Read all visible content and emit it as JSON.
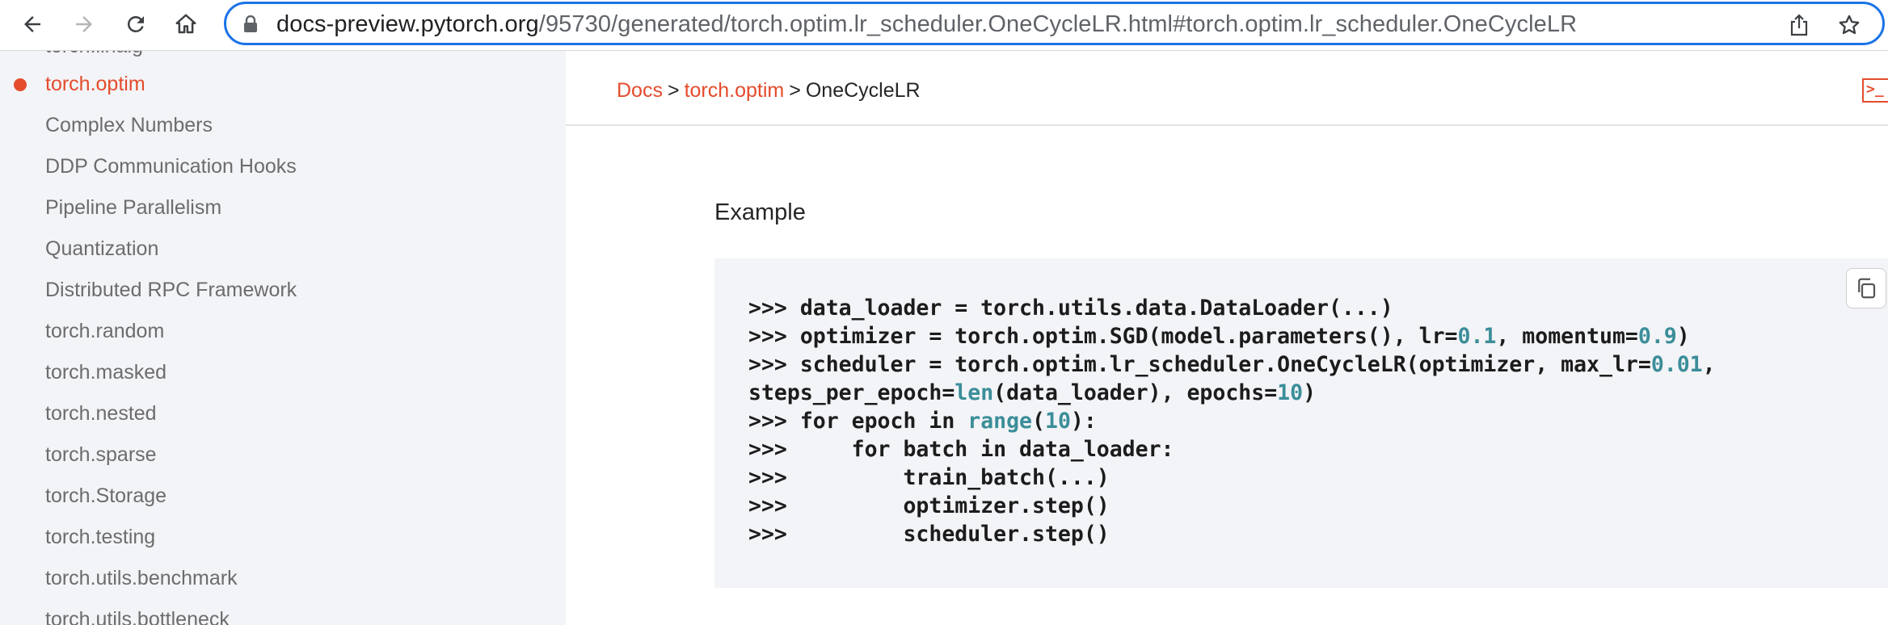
{
  "browser": {
    "url_host": "docs-preview.pytorch.org",
    "url_path": "/95730/generated/torch.optim.lr_scheduler.OneCycleLR.html#torch.optim.lr_scheduler.OneCycleLR"
  },
  "sidebar": {
    "partial_top": "torch.linalg",
    "items": [
      {
        "label": "torch.optim",
        "active": true
      },
      {
        "label": "Complex Numbers"
      },
      {
        "label": "DDP Communication Hooks"
      },
      {
        "label": "Pipeline Parallelism"
      },
      {
        "label": "Quantization"
      },
      {
        "label": "Distributed RPC Framework"
      },
      {
        "label": "torch.random"
      },
      {
        "label": "torch.masked"
      },
      {
        "label": "torch.nested"
      },
      {
        "label": "torch.sparse"
      },
      {
        "label": "torch.Storage"
      },
      {
        "label": "torch.testing"
      },
      {
        "label": "torch.utils.benchmark"
      },
      {
        "label": "torch.utils.bottleneck"
      }
    ]
  },
  "breadcrumb": {
    "docs": "Docs",
    "section": "torch.optim",
    "current": "OneCycleLR",
    "separator": ">"
  },
  "content": {
    "section_title": "Example",
    "code_lines": [
      [
        {
          "t": ">>> data_loader = torch.utils.data.DataLoader(...)"
        }
      ],
      [
        {
          "t": ">>> optimizer = torch.optim.SGD(model.parameters(), lr="
        },
        {
          "t": "0.1",
          "c": "num"
        },
        {
          "t": ", momentum="
        },
        {
          "t": "0.9",
          "c": "num"
        },
        {
          "t": ")"
        }
      ],
      [
        {
          "t": ">>> scheduler = torch.optim.lr_scheduler.OneCycleLR(optimizer, max_lr="
        },
        {
          "t": "0.01",
          "c": "num"
        },
        {
          "t": ","
        }
      ],
      [
        {
          "t": "steps_per_epoch="
        },
        {
          "t": "len",
          "c": "bi"
        },
        {
          "t": "(data_loader), epochs="
        },
        {
          "t": "10",
          "c": "num"
        },
        {
          "t": ")"
        }
      ],
      [
        {
          "t": ">>> for epoch in "
        },
        {
          "t": "range",
          "c": "bi"
        },
        {
          "t": "("
        },
        {
          "t": "10",
          "c": "num"
        },
        {
          "t": "):"
        }
      ],
      [
        {
          "t": ">>>     for batch in data_loader:"
        }
      ],
      [
        {
          "t": ">>>         train_batch(...)"
        }
      ],
      [
        {
          "t": ">>>         optimizer.step()"
        }
      ],
      [
        {
          "t": ">>>         scheduler.step()"
        }
      ]
    ]
  },
  "colors": {
    "accent": "#e44c2c",
    "sidebar_bg": "#f3f4f7",
    "code_number": "#3b8e99",
    "focus_ring": "#1a73e8"
  },
  "icons": [
    "back-icon",
    "forward-icon",
    "reload-icon",
    "home-icon",
    "lock-icon",
    "share-icon",
    "bookmark-star-icon",
    "terminal-icon",
    "copy-icon"
  ]
}
